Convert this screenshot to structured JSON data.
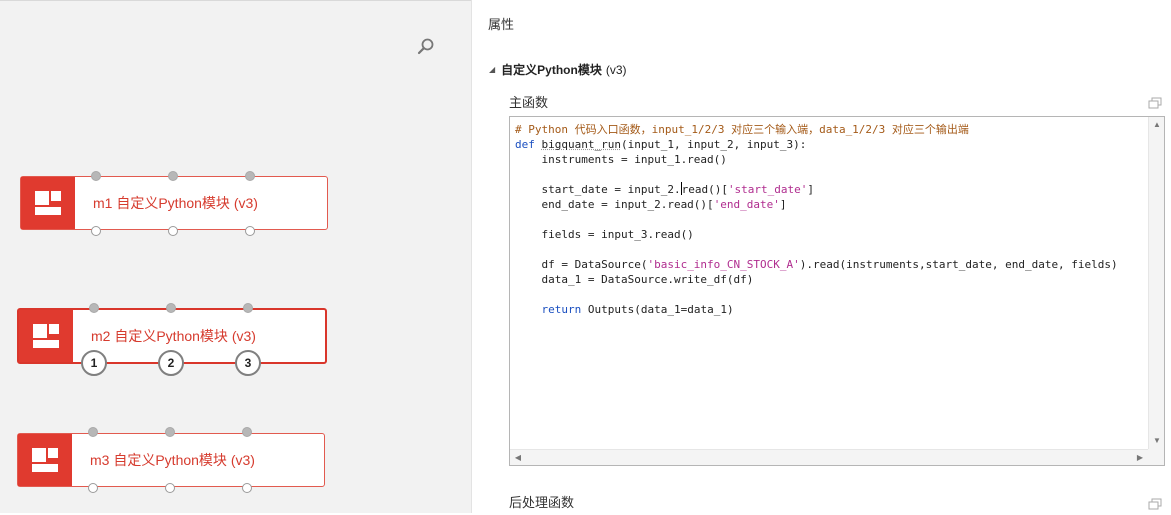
{
  "modules": [
    {
      "title": "m1 自定义Python模块 (v3)"
    },
    {
      "title": "m2 自定义Python模块 (v3)",
      "port_numbers": [
        "1",
        "2",
        "3"
      ]
    },
    {
      "title": "m3 自定义Python模块 (v3)"
    }
  ],
  "panel": {
    "title": "属性",
    "section": {
      "name": "自定义Python模块",
      "version": "(v3)"
    },
    "main_label": "主函数",
    "post_label": "后处理函数"
  },
  "code": {
    "comment": "# Python 代码入口函数，input_1/2/3 对应三个输入端，data_1/2/3 对应三个输出端",
    "def_keyword": "def",
    "func_name": "bigquant_run",
    "def_rest": "(input_1, input_2, input_3):",
    "line_instruments": "    instruments = input_1.read()",
    "line_start_a": "    start_date = input_2.",
    "line_start_b": "read()[",
    "line_start_str": "'start_date'",
    "line_start_c": "]",
    "line_end_a": "    end_date = input_2.read()[",
    "line_end_str": "'end_date'",
    "line_end_c": "]",
    "line_fields": "    fields = input_3.read()",
    "line_df_a": "    df = DataSource(",
    "line_df_str": "'basic_info_CN_STOCK_A'",
    "line_df_c": ").read(instruments,start_date, end_date, fields)",
    "line_data1": "    data_1 = DataSource.write_df(df)",
    "return_indent": "    ",
    "return_keyword": "return",
    "return_rest": " Outputs(data_1=data_1)"
  },
  "colors": {
    "accent": "#e03a2f",
    "module_text": "#d63b2e",
    "code_comment": "#a45a18",
    "code_keyword": "#1a4fc0",
    "code_string": "#b02d8f"
  },
  "icons": [
    "search-icon",
    "module-icon",
    "expand-icon",
    "collapse-triangle-icon"
  ]
}
